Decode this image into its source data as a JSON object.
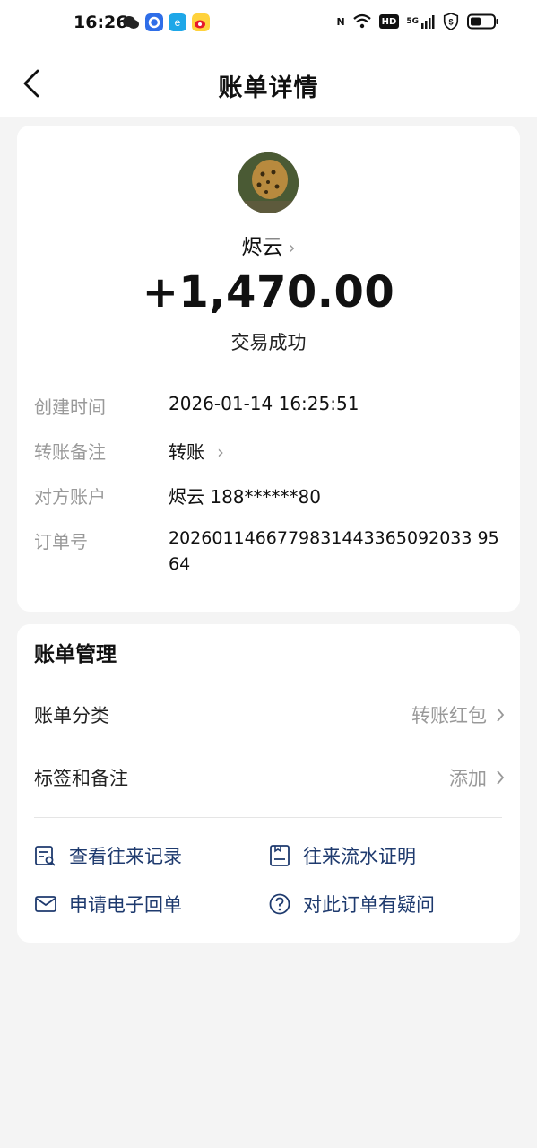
{
  "status_bar": {
    "time": "16:26",
    "right_icons": [
      "N",
      "HD",
      "5G"
    ]
  },
  "nav": {
    "title": "账单详情"
  },
  "transaction": {
    "name": "烬云",
    "amount": "+1,470.00",
    "status": "交易成功"
  },
  "details": [
    {
      "label": "创建时间",
      "value": "2026-01-14 16:25:51"
    },
    {
      "label": "转账备注",
      "value": "转账"
    },
    {
      "label": "对方账户",
      "value": "烬云 188******80"
    },
    {
      "label": "订单号",
      "value": "2026011466779831443365092033 9564"
    }
  ],
  "management": {
    "title": "账单管理",
    "category_label": "账单分类",
    "category_value": "转账红包",
    "tags_label": "标签和备注",
    "tags_value": "添加",
    "actions": [
      {
        "label": "查看往来记录",
        "icon": "records-search-icon"
      },
      {
        "label": "往来流水证明",
        "icon": "statement-certificate-icon"
      },
      {
        "label": "申请电子回单",
        "icon": "mail-icon"
      },
      {
        "label": "对此订单有疑问",
        "icon": "question-icon"
      }
    ]
  },
  "colors": {
    "accent": "#1e3a6e",
    "muted": "#999999",
    "background": "#f4f4f4"
  }
}
